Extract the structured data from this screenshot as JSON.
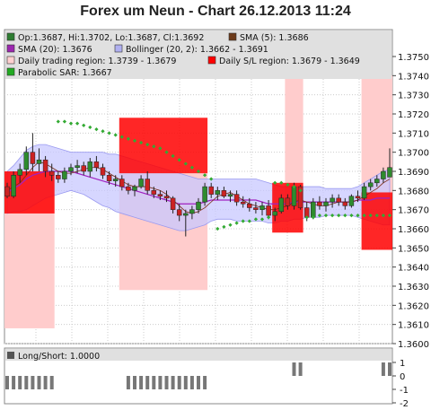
{
  "title": "Forex um Neun - Chart 26.12.2013 11:24",
  "legend": [
    {
      "label": "Op:1.3687, Hi:1.3702, Lo:1.3687, Cl:1.3692",
      "color": "#2e7d32"
    },
    {
      "label": "SMA (5): 1.3686",
      "color": "#6d3b1a"
    },
    {
      "label": "SMA (20): 1.3676",
      "color": "#9c27b0"
    },
    {
      "label": "Bollinger (20, 2): 1.3662 - 1.3691",
      "color": "#b0b0f0"
    },
    {
      "label": "Daily trading region: 1.3739 - 1.3679",
      "color": "#ffd0d0"
    },
    {
      "label": "Daily S/L region: 1.3679 - 1.3649",
      "color": "#ff0000"
    },
    {
      "label": "Parabolic SAR: 1.3667",
      "color": "#22aa22"
    }
  ],
  "colors": {
    "up": "#2e8b2e",
    "down": "#cc2222",
    "bollinger": "#c8c8ff",
    "bollinger_line": "#9a9af0",
    "sma20": "#a020c0",
    "sma5": "#7a2a10",
    "trading": "#ffcccc",
    "stoploss": "#ff0000",
    "sar": "#33aa33",
    "grid": "#cccccc",
    "panel_header": "#e0e0e0"
  },
  "chart_data": [
    {
      "type": "candlestick",
      "ylim": [
        1.36,
        1.375
      ],
      "yticks": [
        "1.3600",
        "1.3610",
        "1.3620",
        "1.3630",
        "1.3640",
        "1.3650",
        "1.3660",
        "1.3670",
        "1.3680",
        "1.3690",
        "1.3700",
        "1.3710",
        "1.3720",
        "1.3730",
        "1.3740",
        "1.3750"
      ],
      "candles": [
        [
          1.3682,
          1.3684,
          1.3676,
          1.3677
        ],
        [
          1.3677,
          1.369,
          1.3676,
          1.3688
        ],
        [
          1.3688,
          1.3694,
          1.3684,
          1.3691
        ],
        [
          1.3691,
          1.3703,
          1.3688,
          1.37
        ],
        [
          1.37,
          1.371,
          1.369,
          1.3694
        ],
        [
          1.3694,
          1.3702,
          1.369,
          1.3696
        ],
        [
          1.3696,
          1.3698,
          1.3687,
          1.369
        ],
        [
          1.369,
          1.3694,
          1.3685,
          1.3688
        ],
        [
          1.3688,
          1.369,
          1.3684,
          1.3686
        ],
        [
          1.3686,
          1.3692,
          1.3684,
          1.369
        ],
        [
          1.369,
          1.3694,
          1.3688,
          1.3692
        ],
        [
          1.3692,
          1.3696,
          1.3689,
          1.3693
        ],
        [
          1.3693,
          1.3695,
          1.3688,
          1.369
        ],
        [
          1.369,
          1.3697,
          1.3687,
          1.3695
        ],
        [
          1.3695,
          1.3698,
          1.369,
          1.3692
        ],
        [
          1.3692,
          1.3694,
          1.3686,
          1.3688
        ],
        [
          1.3688,
          1.369,
          1.3683,
          1.3685
        ],
        [
          1.3685,
          1.3688,
          1.3682,
          1.3686
        ],
        [
          1.3686,
          1.3688,
          1.368,
          1.3682
        ],
        [
          1.3682,
          1.3684,
          1.3678,
          1.368
        ],
        [
          1.368,
          1.3683,
          1.3677,
          1.3682
        ],
        [
          1.3682,
          1.3688,
          1.3681,
          1.3686
        ],
        [
          1.3686,
          1.369,
          1.3678,
          1.368
        ],
        [
          1.368,
          1.3682,
          1.3676,
          1.3678
        ],
        [
          1.3678,
          1.368,
          1.3675,
          1.3677
        ],
        [
          1.3677,
          1.368,
          1.3674,
          1.3676
        ],
        [
          1.3676,
          1.3677,
          1.3668,
          1.367
        ],
        [
          1.367,
          1.3673,
          1.3664,
          1.3667
        ],
        [
          1.3667,
          1.367,
          1.3656,
          1.3668
        ],
        [
          1.3668,
          1.3672,
          1.3665,
          1.367
        ],
        [
          1.367,
          1.3676,
          1.3668,
          1.3674
        ],
        [
          1.3674,
          1.3684,
          1.3672,
          1.3682
        ],
        [
          1.3682,
          1.3684,
          1.3676,
          1.3678
        ],
        [
          1.3678,
          1.3682,
          1.3675,
          1.368
        ],
        [
          1.368,
          1.3682,
          1.3676,
          1.3677
        ],
        [
          1.3677,
          1.368,
          1.3674,
          1.3678
        ],
        [
          1.3678,
          1.368,
          1.3672,
          1.3674
        ],
        [
          1.3674,
          1.3677,
          1.3671,
          1.3673
        ],
        [
          1.3673,
          1.3676,
          1.3669,
          1.3671
        ],
        [
          1.3671,
          1.3674,
          1.3668,
          1.367
        ],
        [
          1.367,
          1.3674,
          1.3667,
          1.3672
        ],
        [
          1.3672,
          1.3675,
          1.3665,
          1.3667
        ],
        [
          1.3667,
          1.3671,
          1.3664,
          1.3669
        ],
        [
          1.3669,
          1.3678,
          1.3668,
          1.3676
        ],
        [
          1.3676,
          1.3678,
          1.367,
          1.3672
        ],
        [
          1.3672,
          1.3684,
          1.367,
          1.3682
        ],
        [
          1.3682,
          1.3683,
          1.367,
          1.3671
        ],
        [
          1.3671,
          1.3674,
          1.3664,
          1.3666
        ],
        [
          1.3666,
          1.3676,
          1.3665,
          1.3674
        ],
        [
          1.3674,
          1.3677,
          1.367,
          1.3672
        ],
        [
          1.3672,
          1.3676,
          1.3669,
          1.3674
        ],
        [
          1.3674,
          1.3678,
          1.3671,
          1.3676
        ],
        [
          1.3676,
          1.3678,
          1.3672,
          1.3674
        ],
        [
          1.3674,
          1.3676,
          1.367,
          1.3672
        ],
        [
          1.3672,
          1.3678,
          1.3671,
          1.3677
        ],
        [
          1.3677,
          1.368,
          1.3674,
          1.3676
        ],
        [
          1.3676,
          1.3684,
          1.3675,
          1.3682
        ],
        [
          1.3682,
          1.3686,
          1.368,
          1.3684
        ],
        [
          1.3684,
          1.3688,
          1.3682,
          1.3686
        ],
        [
          1.3686,
          1.3692,
          1.3684,
          1.369
        ],
        [
          1.3687,
          1.3702,
          1.3687,
          1.3692
        ]
      ],
      "sma20": [
        1.3679,
        1.3681,
        1.3683,
        1.3686,
        1.3688,
        1.3689,
        1.369,
        1.369,
        1.369,
        1.369,
        1.369,
        1.3689,
        1.3688,
        1.3687,
        1.3686,
        1.3685,
        1.3684,
        1.3683,
        1.3682,
        1.3681,
        1.368,
        1.3679,
        1.3678,
        1.3677,
        1.3676,
        1.3675,
        1.3674,
        1.3673,
        1.3673,
        1.3673,
        1.3673,
        1.3674,
        1.3675,
        1.3675,
        1.3675,
        1.3675,
        1.3675,
        1.3675,
        1.3675,
        1.3675,
        1.3674,
        1.3673,
        1.3673,
        1.3673,
        1.3673,
        1.3674,
        1.3674,
        1.3674,
        1.3674,
        1.3674,
        1.3674,
        1.3674,
        1.3674,
        1.3674,
        1.3674,
        1.3675,
        1.3675,
        1.3675,
        1.3676,
        1.3676,
        1.3676
      ],
      "sma5": [
        1.368,
        1.3682,
        1.3684,
        1.3688,
        1.3692,
        1.3695,
        1.3694,
        1.3692,
        1.369,
        1.3689,
        1.3689,
        1.369,
        1.3691,
        1.3692,
        1.3692,
        1.3691,
        1.3689,
        1.3687,
        1.3685,
        1.3683,
        1.3682,
        1.3682,
        1.3682,
        1.3681,
        1.368,
        1.3678,
        1.3675,
        1.3672,
        1.3669,
        1.3668,
        1.3669,
        1.3671,
        1.3674,
        1.3677,
        1.3678,
        1.3679,
        1.3677,
        1.3675,
        1.3673,
        1.3672,
        1.3671,
        1.367,
        1.367,
        1.3671,
        1.3672,
        1.3674,
        1.3675,
        1.3674,
        1.3673,
        1.3672,
        1.3672,
        1.3673,
        1.3674,
        1.3674,
        1.3674,
        1.3675,
        1.3677,
        1.3679,
        1.3681,
        1.3684,
        1.3686
      ],
      "boll_upper": [
        1.369,
        1.3693,
        1.3697,
        1.3701,
        1.3703,
        1.3704,
        1.3704,
        1.3703,
        1.3702,
        1.3701,
        1.37,
        1.37,
        1.37,
        1.37,
        1.37,
        1.37,
        1.3699,
        1.3699,
        1.3698,
        1.3697,
        1.3696,
        1.3695,
        1.3694,
        1.3693,
        1.3692,
        1.3691,
        1.369,
        1.3689,
        1.3688,
        1.3687,
        1.3686,
        1.3686,
        1.3686,
        1.3686,
        1.3686,
        1.3686,
        1.3686,
        1.3686,
        1.3686,
        1.3686,
        1.3685,
        1.3684,
        1.3683,
        1.3682,
        1.3682,
        1.3682,
        1.3682,
        1.3682,
        1.3682,
        1.3682,
        1.3681,
        1.3681,
        1.3681,
        1.3681,
        1.3681,
        1.3682,
        1.3684,
        1.3686,
        1.3688,
        1.369,
        1.3691
      ],
      "boll_lower": [
        1.3668,
        1.3669,
        1.3669,
        1.367,
        1.3672,
        1.3674,
        1.3676,
        1.3677,
        1.3678,
        1.3679,
        1.368,
        1.3679,
        1.3678,
        1.3676,
        1.3674,
        1.3672,
        1.3671,
        1.3669,
        1.3668,
        1.3667,
        1.3666,
        1.3665,
        1.3664,
        1.3663,
        1.3662,
        1.3661,
        1.366,
        1.3659,
        1.3659,
        1.366,
        1.3661,
        1.3662,
        1.3664,
        1.3665,
        1.3665,
        1.3665,
        1.3664,
        1.3664,
        1.3664,
        1.3664,
        1.3664,
        1.3663,
        1.3663,
        1.3664,
        1.3664,
        1.3665,
        1.3665,
        1.3666,
        1.3666,
        1.3666,
        1.3667,
        1.3667,
        1.3667,
        1.3667,
        1.3667,
        1.3666,
        1.3665,
        1.3664,
        1.3663,
        1.3662,
        1.3662
      ],
      "sar": [
        null,
        null,
        null,
        null,
        null,
        null,
        null,
        null,
        1.3716,
        1.3716,
        1.3715,
        1.3715,
        1.3714,
        1.3713,
        1.3712,
        1.3711,
        1.371,
        1.3709,
        1.3708,
        1.3707,
        1.3706,
        1.3705,
        1.3704,
        1.3703,
        1.3702,
        1.37,
        1.3698,
        1.3696,
        1.3694,
        1.3692,
        1.369,
        1.3688,
        1.3686,
        1.366,
        1.3661,
        1.3662,
        1.3663,
        1.3664,
        1.3664,
        1.3665,
        1.3665,
        1.3666,
        1.3684,
        1.3684,
        1.3683,
        1.3682,
        1.368,
        1.3666,
        1.3666,
        1.3667,
        1.3667,
        1.3667,
        1.3667,
        1.3667,
        1.3667,
        1.3667,
        1.3667,
        1.3667,
        1.3667,
        1.3667,
        1.3667
      ],
      "trading_regions": [
        {
          "from": 0,
          "to": 7,
          "top": 1.369,
          "bottom": 1.3608
        },
        {
          "from": 18,
          "to": 31,
          "top": 1.3689,
          "bottom": 1.3628
        },
        {
          "from": 44,
          "to": 46,
          "top": 1.374,
          "bottom": 1.3672
        },
        {
          "from": 56,
          "to": 60,
          "top": 1.374,
          "bottom": 1.3679
        }
      ],
      "sl_regions": [
        {
          "from": 0,
          "to": 7,
          "top": 1.369,
          "bottom": 1.3668
        },
        {
          "from": 18,
          "to": 31,
          "top": 1.3718,
          "bottom": 1.3689
        },
        {
          "from": 42,
          "to": 46,
          "top": 1.3684,
          "bottom": 1.3658
        },
        {
          "from": 56,
          "to": 60,
          "top": 1.3679,
          "bottom": 1.3649
        }
      ]
    },
    {
      "type": "bar",
      "label": "Long/Short: 1.0000",
      "ylim": [
        -2,
        1
      ],
      "yticks": [
        "1",
        "0",
        "-1",
        "-2"
      ],
      "values": [
        -1,
        -1,
        -1,
        -1,
        -1,
        -1,
        -1,
        -1,
        0,
        0,
        0,
        0,
        0,
        0,
        0,
        0,
        0,
        0,
        0,
        -1,
        -1,
        -1,
        -1,
        -1,
        -1,
        -1,
        -1,
        -1,
        -1,
        -1,
        -1,
        -1,
        0,
        0,
        0,
        0,
        0,
        0,
        0,
        0,
        0,
        0,
        0,
        0,
        0,
        1,
        1,
        0,
        0,
        0,
        0,
        0,
        0,
        0,
        0,
        0,
        0,
        0,
        0,
        1,
        1
      ]
    }
  ]
}
